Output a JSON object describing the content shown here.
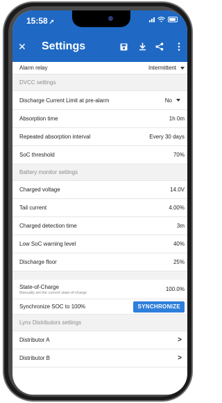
{
  "status_bar": {
    "time": "15:58",
    "location_icon": "location-arrow-icon"
  },
  "header": {
    "title": "Settings",
    "close_icon": "close-icon",
    "actions": [
      "save-icon",
      "download-icon",
      "share-icon",
      "more-vertical-icon"
    ]
  },
  "rows": {
    "alarm_relay": {
      "label": "Alarm relay",
      "value": "Intermittent"
    },
    "dvcc_header": "DVCC settings",
    "discharge_limit": {
      "label": "Discharge Current Limit at pre-alarm",
      "value": "No"
    },
    "absorption_time": {
      "label": "Absorption time",
      "value": "1h 0m"
    },
    "repeated_absorption": {
      "label": "Repeated absorption interval",
      "value": "Every 30 days"
    },
    "soc_threshold": {
      "label": "SoC threshold",
      "value": "70%"
    },
    "battery_header": "Battery monitor settings",
    "charged_voltage": {
      "label": "Charged voltage",
      "value": "14.0V"
    },
    "tail_current": {
      "label": "Tail current",
      "value": "4.00%"
    },
    "charged_detection": {
      "label": "Charged detection time",
      "value": "3m"
    },
    "low_soc": {
      "label": "Low SoC warning level",
      "value": "40%"
    },
    "discharge_floor": {
      "label": "Discharge floor",
      "value": "25%"
    },
    "state_of_charge": {
      "label": "State-of-Charge",
      "subtitle": "Manually set the current state-of-charge",
      "value": "100.0%"
    },
    "sync_soc": {
      "label": "Synchronize SOC to 100%",
      "button": "SYNCHRONIZE"
    },
    "lynx_header": "Lynx Distributors settings",
    "distributor_a": {
      "label": "Distributor A"
    },
    "distributor_b": {
      "label": "Distributor B"
    }
  },
  "colors": {
    "header": "#1f69c4",
    "accent_button": "#2f7fdc",
    "section_bg": "#f2f2f2"
  }
}
